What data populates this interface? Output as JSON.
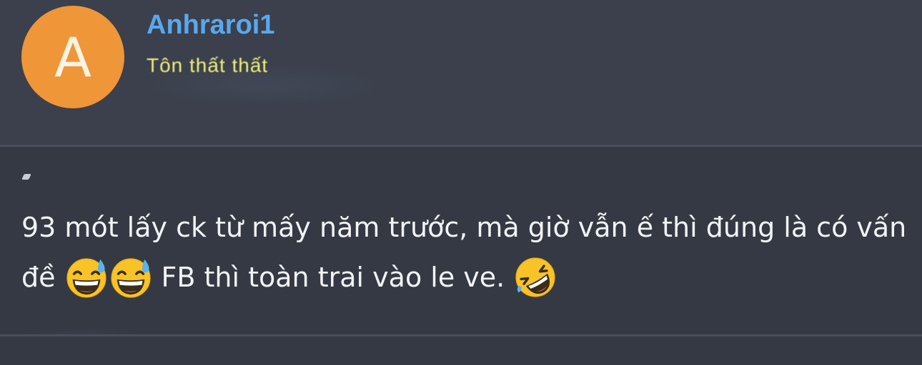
{
  "user": {
    "avatar_letter": "A",
    "avatar_color": "#ef9638",
    "username": "Anhraroi1",
    "title": "Tôn thất thất"
  },
  "post": {
    "line1": "93 mót lấy ck từ mấy năm trước, mà giờ vẫn ế thì đúng là có vấn",
    "line2_start": "đề",
    "line2_middle": "FB thì toàn trai vào le ve.",
    "emojis": [
      "grinning-sweat-emoji",
      "grinning-sweat-emoji",
      "rolling-laughing-emoji"
    ]
  },
  "colors": {
    "username": "#5aa8ec",
    "title": "#f1ef7c",
    "text": "#f2f3f5",
    "header_bg": "#3b404c",
    "body_bg": "#353944"
  }
}
